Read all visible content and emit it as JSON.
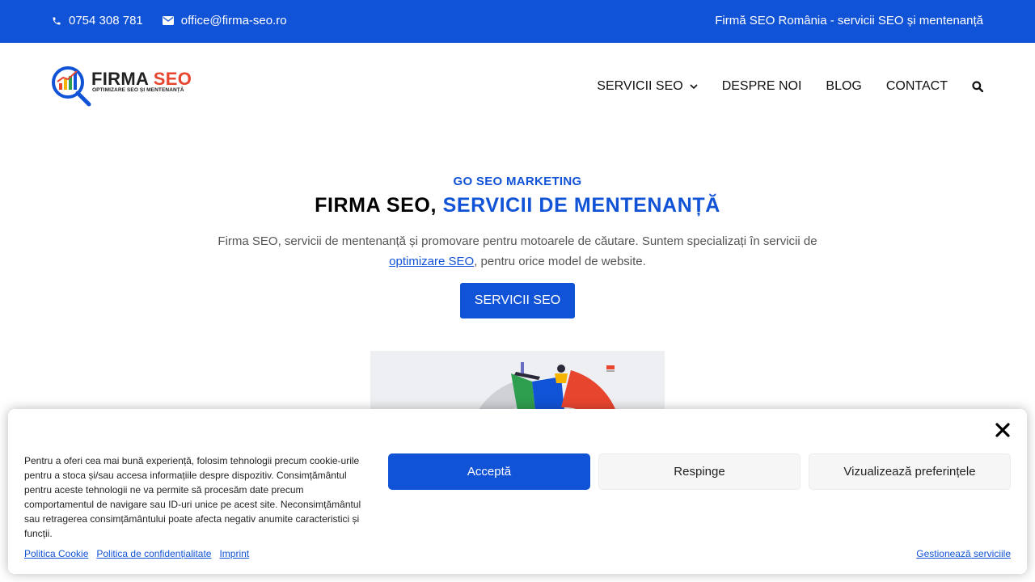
{
  "topbar": {
    "phone": "0754 308 781",
    "email": "office@firma-seo.ro",
    "tagline": "Firmă SEO România - servicii SEO și mentenanță"
  },
  "logo": {
    "text_main": "FIRMA ",
    "text_accent": "SEO",
    "tagline": "OPTIMIZARE SEO ȘI MENTENANȚĂ"
  },
  "nav": {
    "items": [
      {
        "label": "SERVICII SEO"
      },
      {
        "label": "DESPRE NOI"
      },
      {
        "label": "BLOG"
      },
      {
        "label": "CONTACT"
      }
    ]
  },
  "hero": {
    "eyebrow": "GO SEO MARKETING",
    "title_black": "FIRMA SEO, ",
    "title_blue": "SERVICII DE MENTENANȚĂ",
    "desc_part1": "Firma SEO, servicii de mentenanță și promovare pentru motoarele de căutare. Suntem specializați în servicii de ",
    "desc_link": "optimizare SEO",
    "desc_part2": ", pentru orice model de website.",
    "cta": "SERVICII SEO"
  },
  "cookie": {
    "text": "Pentru a oferi cea mai bună experiență, folosim tehnologii precum cookie-urile pentru a stoca și/sau accesa informațiile despre dispozitiv. Consimțământul pentru aceste tehnologii ne va permite să procesăm date precum comportamentul de navigare sau ID-uri unice pe acest site. Neconsimțământul sau retragerea consimțământului poate afecta negativ anumite caracteristici și funcții.",
    "accept": "Acceptă",
    "deny": "Respinge",
    "prefs": "Vizualizează preferințele",
    "links": [
      "Politica Cookie",
      "Politica de confidențialitate",
      "Imprint"
    ],
    "manage": "Gestionează serviciile"
  },
  "colors": {
    "brand_blue": "#1153d6",
    "accent_red": "#e8452f"
  }
}
